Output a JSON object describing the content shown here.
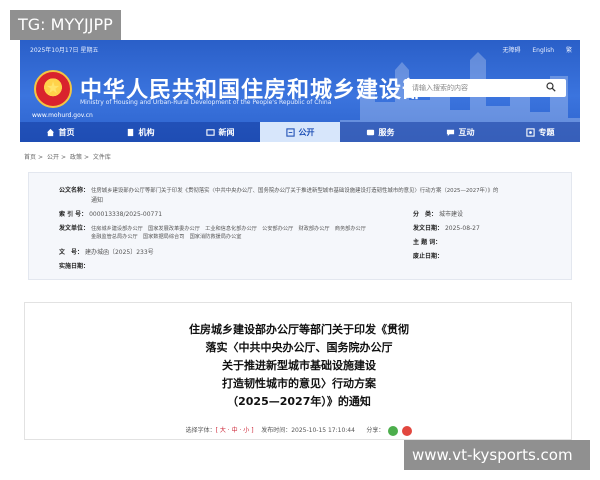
{
  "watermarks": {
    "top": "TG: MYYJJPP",
    "bottom": "www.vt-kysports.com"
  },
  "header": {
    "date": "2025年10月17日 星期五",
    "top_links": [
      "无障碍",
      "English",
      "繁"
    ],
    "site_title": "中华人民共和国住房和城乡建设部",
    "site_subtitle": "Ministry of Housing and Urban-Rural Development of the People's Republic of China",
    "site_url": "www.mohurd.gov.cn",
    "search_placeholder": "请输入搜索的内容",
    "accent": "#2f68d2"
  },
  "nav": [
    {
      "label": "首页",
      "icon": "home-icon"
    },
    {
      "label": "机构",
      "icon": "building-icon"
    },
    {
      "label": "新闻",
      "icon": "news-icon"
    },
    {
      "label": "公开",
      "icon": "open-icon",
      "active": true
    },
    {
      "label": "服务",
      "icon": "service-icon"
    },
    {
      "label": "互动",
      "icon": "chat-icon"
    },
    {
      "label": "专题",
      "icon": "topic-icon"
    }
  ],
  "breadcrumb": [
    "首页",
    "公开",
    "政策",
    "文件库"
  ],
  "info": {
    "title_label": "公文名称：",
    "title_value": "住房城乡建设部办公厅等部门关于印发《贯彻落实〈中共中央办公厅、国务院办公厅关于推进新型城市基础设施建设打造韧性城市的意见〉行动方案（2025—2027年）》的",
    "title_value_2": "通知",
    "index_label": "索 引 号：",
    "index_value": "000013338/2025-00771",
    "category_label": "分　类：",
    "category_value": "城市建设",
    "issuer_label": "发文单位：",
    "issuer_line1": "住房城乡建设部办公厅　国家发展改革委办公厅　工业和信息化部办公厅　公安部办公厅　财政部办公厅　商务部办公厅",
    "issuer_line2": "金融监管总局办公厅　国家数据局综合司　国家消防救援局办公室",
    "date_label": "发文日期：",
    "date_value": "2025-08-27",
    "subject_label": "主 题 词：",
    "subject_value": "",
    "doc_label": "文　号：",
    "doc_value": "建办城函〔2025〕233号",
    "expire_label": "废止日期：",
    "expire_value": "",
    "effective_label": "实施日期：",
    "effective_value": ""
  },
  "article": {
    "title_lines": [
      "住房城乡建设部办公厅等部门关于印发《贯彻",
      "落实〈中共中央办公厅、国务院办公厅",
      "关于推进新型城市基础设施建设",
      "打造韧性城市的意见〉行动方案",
      "（2025—2027年）》的通知"
    ],
    "font_size_label": "选择字体：",
    "font_size_options": "[ 大 · 中 · 小 ]",
    "publish_label": "发布时间：",
    "publish_time": "2025-10-15 17:10:44",
    "share_label": "分享："
  }
}
